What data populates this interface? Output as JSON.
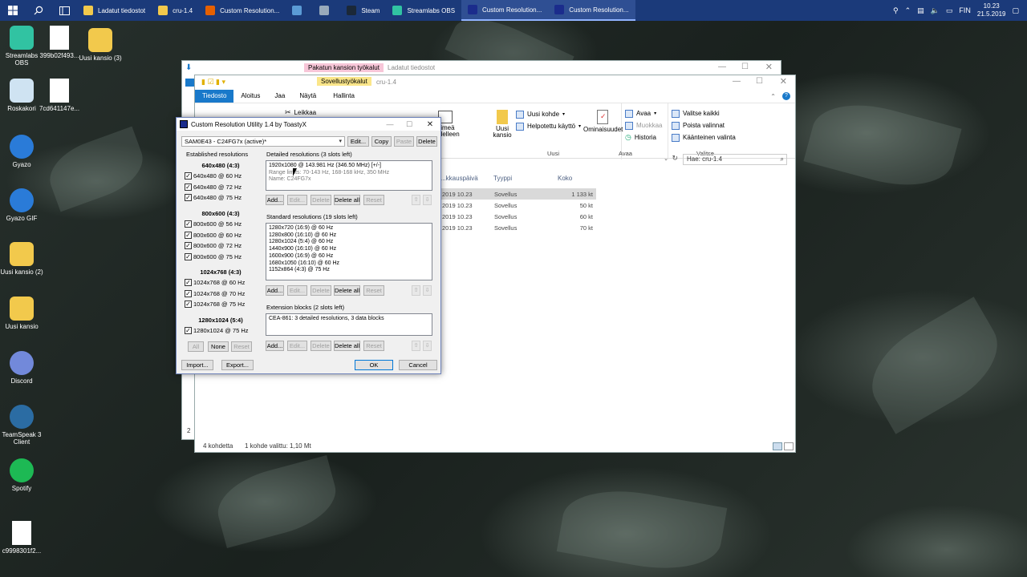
{
  "taskbar": {
    "items": [
      {
        "label": "Ladatut tiedostot",
        "icon": "folder-icon",
        "color": "#f2c94c"
      },
      {
        "label": "cru-1.4",
        "icon": "folder-icon",
        "color": "#f2c94c"
      },
      {
        "label": "Custom Resolution...",
        "icon": "firefox-icon",
        "color": "#e66000"
      },
      {
        "label": "",
        "icon": "mail-icon",
        "color": "#5b9bd5"
      },
      {
        "label": "",
        "icon": "network-icon",
        "color": "#9ab"
      },
      {
        "label": "Steam",
        "icon": "steam-icon",
        "color": "#1b2838"
      },
      {
        "label": "Streamlabs OBS",
        "icon": "streamlabs-icon",
        "color": "#31c3a2"
      },
      {
        "label": "Custom Resolution...",
        "icon": "cru-icon",
        "color": "#1b2c8c"
      },
      {
        "label": "Custom Resolution...",
        "icon": "cru-icon",
        "color": "#1b2c8c"
      }
    ],
    "language": "FIN",
    "time": "10.23",
    "date": "21.5.2019"
  },
  "desktop_icons": [
    {
      "label": "Streamlabs OBS",
      "icon": "streamlabs-icon",
      "color": "#31c3a2"
    },
    {
      "label": "399b02f493...",
      "icon": "file-icon",
      "color": "#ffffff"
    },
    {
      "label": "Uusi kansio (3)",
      "icon": "folder-icon",
      "color": "#f2c94c"
    },
    {
      "label": "Roskakori",
      "icon": "recycle-bin-icon",
      "color": "#cfe3f2"
    },
    {
      "label": "7cd641147e...",
      "icon": "file-icon",
      "color": "#ffffff"
    },
    {
      "label": "Gyazo",
      "icon": "gyazo-icon",
      "color": "#2a7bd8"
    },
    {
      "label": "Gyazo GIF",
      "icon": "gyazo-gif-icon",
      "color": "#2a7bd8"
    },
    {
      "label": "Uusi kansio (2)",
      "icon": "folder-icon",
      "color": "#f2c94c"
    },
    {
      "label": "Uusi kansio",
      "icon": "folder-icon",
      "color": "#f2c94c"
    },
    {
      "label": "Discord",
      "icon": "discord-icon",
      "color": "#7289da"
    },
    {
      "label": "TeamSpeak 3 Client",
      "icon": "teamspeak-icon",
      "color": "#2b6ca3"
    },
    {
      "label": "Spotify",
      "icon": "spotify-icon",
      "color": "#1db954"
    },
    {
      "label": "c9998301f2...",
      "icon": "file-icon",
      "color": "#ffffff"
    }
  ],
  "explorer_back": {
    "ribbon_tab_highlight": "Pakatun kansion työkalut",
    "title": "Ladatut tiedostot"
  },
  "explorer_front": {
    "ribbon_tab_highlight": "Sovellustyökalut",
    "title": "cru-1.4",
    "tabs": [
      "Tiedosto",
      "Aloitus",
      "Jaa",
      "Näytä",
      "Hallinta"
    ],
    "ribbon": {
      "cut": "Leikkaa",
      "rename": "Nimeä uudelleen",
      "new_folder": "Uusi kansio",
      "new_item": "Uusi kohde",
      "easy_access": "Helpotettu käyttö",
      "properties": "Ominaisuudet",
      "open": "Avaa",
      "edit": "Muokkaa",
      "history": "Historia",
      "select_all": "Valitse kaikki",
      "select_none": "Poista valinnat",
      "invert": "Käänteinen valinta",
      "group_new": "Uusi",
      "group_open": "Avaa",
      "group_select": "Valitse"
    },
    "search_placeholder": "Hae: cru-1.4",
    "columns": [
      "...kkauspäivä",
      "Tyyppi",
      "Koko"
    ],
    "files": [
      {
        "date": "2019 10.23",
        "type": "Sovellus",
        "size": "1 133 kt"
      },
      {
        "date": "2019 10.23",
        "type": "Sovellus",
        "size": "50 kt"
      },
      {
        "date": "2019 10.23",
        "type": "Sovellus",
        "size": "60 kt"
      },
      {
        "date": "2019 10.23",
        "type": "Sovellus",
        "size": "70 kt"
      }
    ],
    "status_count": "4 kohdetta",
    "status_selected": "1 kohde valittu: 1,10 Mt"
  },
  "cru": {
    "title": "Custom Resolution Utility 1.4 by ToastyX",
    "monitor": "SAM0E43 - C24FG7x (active)*",
    "top_buttons": {
      "edit": "Edit...",
      "copy": "Copy",
      "paste": "Paste",
      "delete": "Delete"
    },
    "established_title": "Established resolutions",
    "established_groups": [
      {
        "head": "640x480 (4:3)",
        "items": [
          "640x480 @ 60 Hz",
          "640x480 @ 72 Hz",
          "640x480 @ 75 Hz"
        ]
      },
      {
        "head": "800x600 (4:3)",
        "items": [
          "800x600 @ 56 Hz",
          "800x600 @ 60 Hz",
          "800x600 @ 72 Hz",
          "800x600 @ 75 Hz"
        ]
      },
      {
        "head": "1024x768 (4:3)",
        "items": [
          "1024x768 @ 60 Hz",
          "1024x768 @ 70 Hz",
          "1024x768 @ 75 Hz"
        ]
      },
      {
        "head": "1280x1024 (5:4)",
        "items": [
          "1280x1024 @ 75 Hz"
        ]
      }
    ],
    "est_buttons": {
      "all": "All",
      "none": "None",
      "reset": "Reset"
    },
    "detailed_title": "Detailed resolutions (3 slots left)",
    "detailed_lines": [
      "1920x1080 @ 143.981 Hz (346.50 MHz) [+/-]"
    ],
    "detailed_gray_lines": [
      "Range limits: 70-143 Hz, 168-168 kHz, 350 MHz",
      "Name: C24FG7x"
    ],
    "standard_title": "Standard resolutions (19 slots left)",
    "standard_lines": [
      "1280x720 (16:9) @ 60 Hz",
      "1280x800 (16:10) @ 60 Hz",
      "1280x1024 (5:4) @ 60 Hz",
      "1440x900 (16:10) @ 60 Hz",
      "1600x900 (16:9) @ 60 Hz",
      "1680x1050 (16:10) @ 60 Hz",
      "1152x864 (4:3) @ 75 Hz"
    ],
    "extension_title": "Extension blocks (2 slots left)",
    "extension_lines": [
      "CEA-861: 3 detailed resolutions, 3 data blocks"
    ],
    "list_buttons": {
      "add": "Add...",
      "edit": "Edit...",
      "delete": "Delete",
      "delete_all": "Delete all",
      "reset": "Reset"
    },
    "import": "Import...",
    "export": "Export...",
    "ok": "OK",
    "cancel": "Cancel"
  }
}
